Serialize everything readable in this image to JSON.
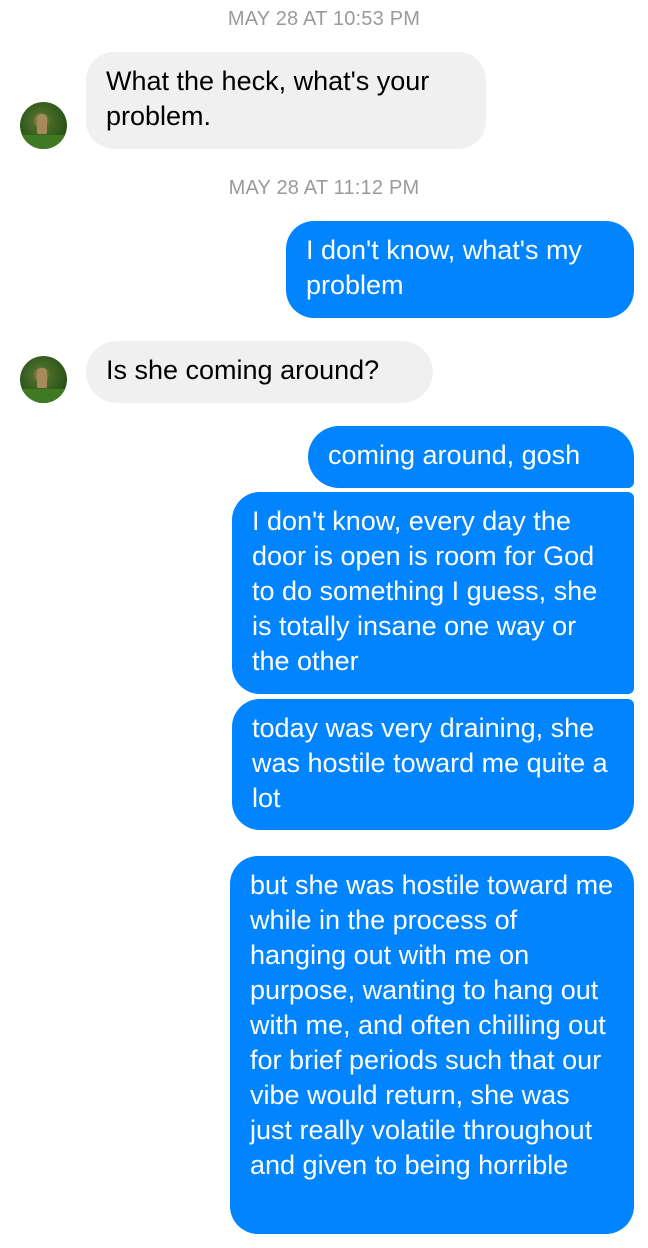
{
  "timestamps": {
    "first": "MAY 28 AT 10:53 PM",
    "second": "MAY 28 AT 11:12 PM"
  },
  "messages": [
    {
      "sender": "them",
      "text": "What the heck, what's your problem."
    },
    {
      "sender": "me",
      "text": "I don't know, what's my problem"
    },
    {
      "sender": "them",
      "text": "Is she coming around?"
    },
    {
      "sender": "me",
      "text": "coming around, gosh"
    },
    {
      "sender": "me",
      "text": "I don't know, every day the door is open is room for God to do something I guess, she is totally insane one way or the other"
    },
    {
      "sender": "me",
      "text": "today was very draining, she was hostile toward me quite a lot"
    },
    {
      "sender": "me",
      "text": "but she was hostile toward me while in the process of hanging out with me on purpose, wanting to hang out with me, and often chilling out for brief periods such that our vibe would return, she was just really volatile throughout and given to being horrible"
    }
  ],
  "colors": {
    "outgoing_bubble": "#0084ff",
    "incoming_bubble": "#f1f0f0",
    "timestamp_text": "#9a9a9a"
  },
  "icons": {
    "avatar": "contact-avatar-photo"
  }
}
